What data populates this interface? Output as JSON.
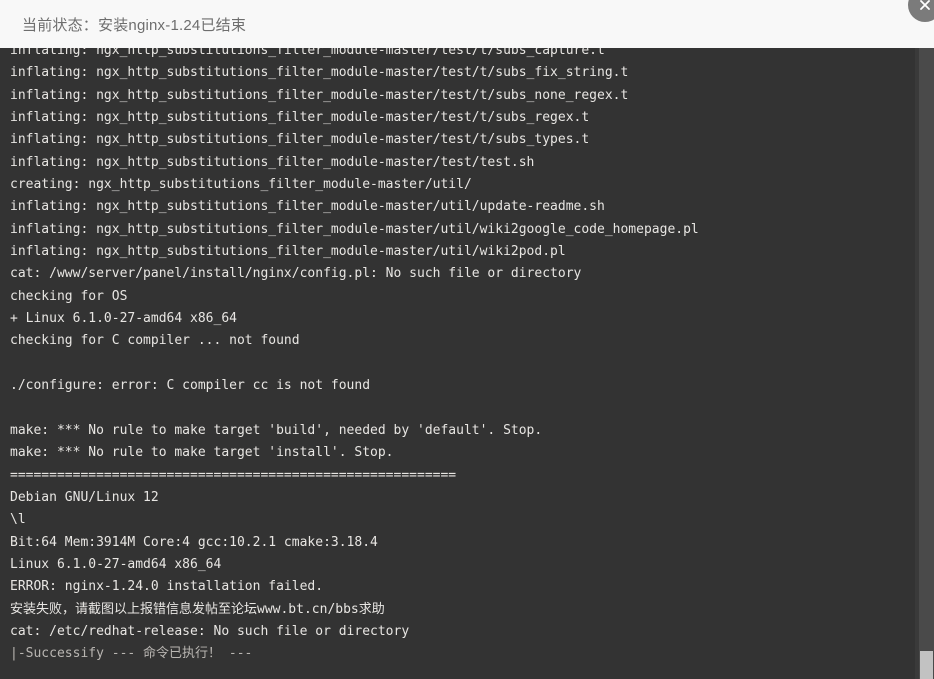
{
  "header": {
    "title": "当前状态：安装nginx-1.24已结束",
    "close_icon": "close-icon"
  },
  "scrollbar": {
    "name": "vertical-scrollbar"
  },
  "terminal": {
    "lines": [
      {
        "text": "inflating: ngx_http_substitutions_filter_module-master/test/t/subs_capture.t",
        "dim": false
      },
      {
        "text": "inflating: ngx_http_substitutions_filter_module-master/test/t/subs_fix_string.t",
        "dim": false
      },
      {
        "text": "inflating: ngx_http_substitutions_filter_module-master/test/t/subs_none_regex.t",
        "dim": false
      },
      {
        "text": "inflating: ngx_http_substitutions_filter_module-master/test/t/subs_regex.t",
        "dim": false
      },
      {
        "text": "inflating: ngx_http_substitutions_filter_module-master/test/t/subs_types.t",
        "dim": false
      },
      {
        "text": "inflating: ngx_http_substitutions_filter_module-master/test/test.sh",
        "dim": false
      },
      {
        "text": "creating: ngx_http_substitutions_filter_module-master/util/",
        "dim": false
      },
      {
        "text": "inflating: ngx_http_substitutions_filter_module-master/util/update-readme.sh",
        "dim": false
      },
      {
        "text": "inflating: ngx_http_substitutions_filter_module-master/util/wiki2google_code_homepage.pl",
        "dim": false
      },
      {
        "text": "inflating: ngx_http_substitutions_filter_module-master/util/wiki2pod.pl",
        "dim": false
      },
      {
        "text": "cat: /www/server/panel/install/nginx/config.pl: No such file or directory",
        "dim": false
      },
      {
        "text": "checking for OS",
        "dim": false
      },
      {
        "text": "+ Linux 6.1.0-27-amd64 x86_64",
        "dim": false
      },
      {
        "text": "checking for C compiler ... not found",
        "dim": false
      },
      {
        "text": "",
        "dim": false
      },
      {
        "text": "./configure: error: C compiler cc is not found",
        "dim": false
      },
      {
        "text": "",
        "dim": false
      },
      {
        "text": "make: *** No rule to make target 'build', needed by 'default'. Stop.",
        "dim": false
      },
      {
        "text": "make: *** No rule to make target 'install'. Stop.",
        "dim": false
      },
      {
        "text": "=========================================================",
        "dim": false
      },
      {
        "text": "Debian GNU/Linux 12",
        "dim": false
      },
      {
        "text": "\\l",
        "dim": false
      },
      {
        "text": "Bit:64 Mem:3914M Core:4 gcc:10.2.1 cmake:3.18.4",
        "dim": false
      },
      {
        "text": "Linux 6.1.0-27-amd64 x86_64",
        "dim": false
      },
      {
        "text": "ERROR: nginx-1.24.0 installation failed.",
        "dim": false
      },
      {
        "text": "安装失败，请截图以上报错信息发帖至论坛www.bt.cn/bbs求助",
        "dim": false
      },
      {
        "text": "cat: /etc/redhat-release: No such file or directory",
        "dim": false
      },
      {
        "text": "|-Successify --- 命令已执行！ ---",
        "dim": true
      }
    ]
  }
}
